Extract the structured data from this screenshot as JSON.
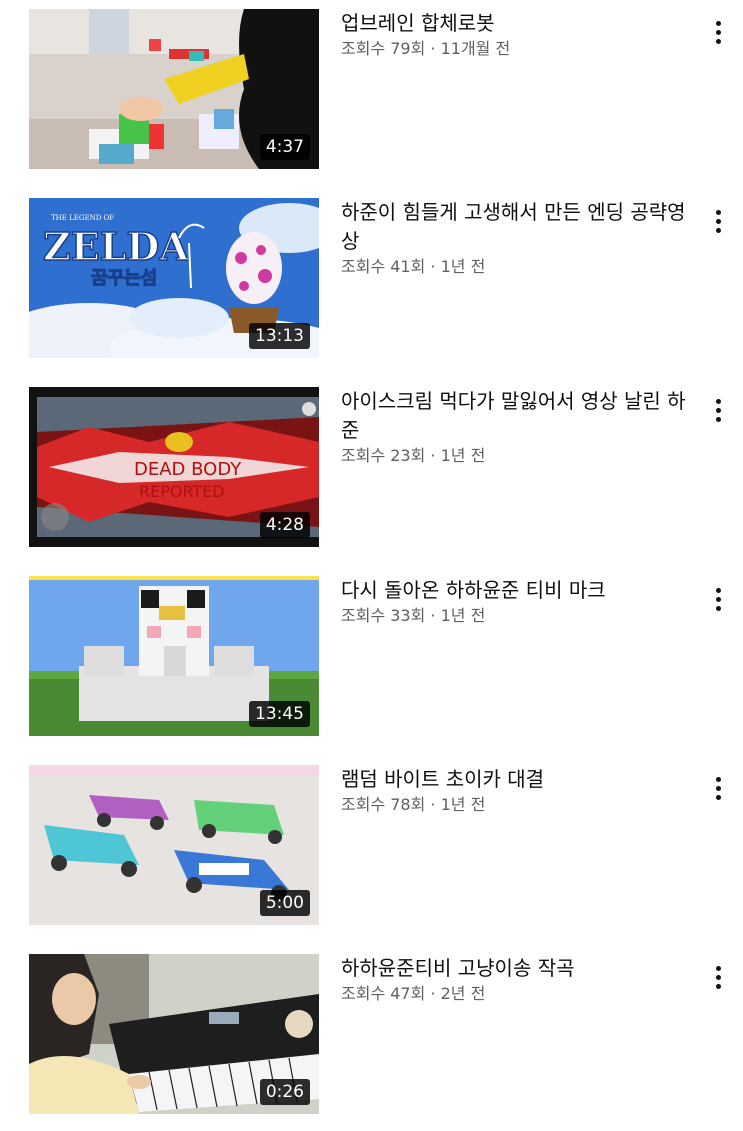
{
  "videos": [
    {
      "title": "업브레인 합체로봇",
      "views": "조회수 79회",
      "age": "11개월 전",
      "duration": "4:37",
      "thumb_icon": "robot-blocks-thumbnail"
    },
    {
      "title": "하준이 힘들게 고생해서 만든 엔딩 공략영상",
      "views": "조회수 41회",
      "age": "1년 전",
      "duration": "13:13",
      "thumb_icon": "zelda-game-thumbnail",
      "thumb_text": [
        "THE LEGEND OF",
        "ZELDA",
        "꿈꾸는섬"
      ]
    },
    {
      "title": "아이스크림 먹다가 말잃어서 영상 날린 하준",
      "views": "조회수 23회",
      "age": "1년 전",
      "duration": "4:28",
      "thumb_icon": "among-us-thumbnail",
      "thumb_text": [
        "DEAD BODY",
        "REPORTED"
      ]
    },
    {
      "title": "다시 돌아온 하하윤준 티비 마크",
      "views": "조회수 33회",
      "age": "1년 전",
      "duration": "13:45",
      "thumb_icon": "minecraft-thumbnail"
    },
    {
      "title": "램덤 바이트 초이카 대결",
      "views": "조회수 78회",
      "age": "1년 전",
      "duration": "5:00",
      "thumb_icon": "toy-cars-thumbnail"
    },
    {
      "title": "하하윤준티비 고냥이송 작곡",
      "views": "조회수 47회",
      "age": "2년 전",
      "duration": "0:26",
      "thumb_icon": "keyboard-piano-thumbnail"
    }
  ],
  "separator": " · ",
  "colors": {
    "title": "#0f0f0f",
    "meta": "#606060",
    "duration_bg": "#000000"
  }
}
